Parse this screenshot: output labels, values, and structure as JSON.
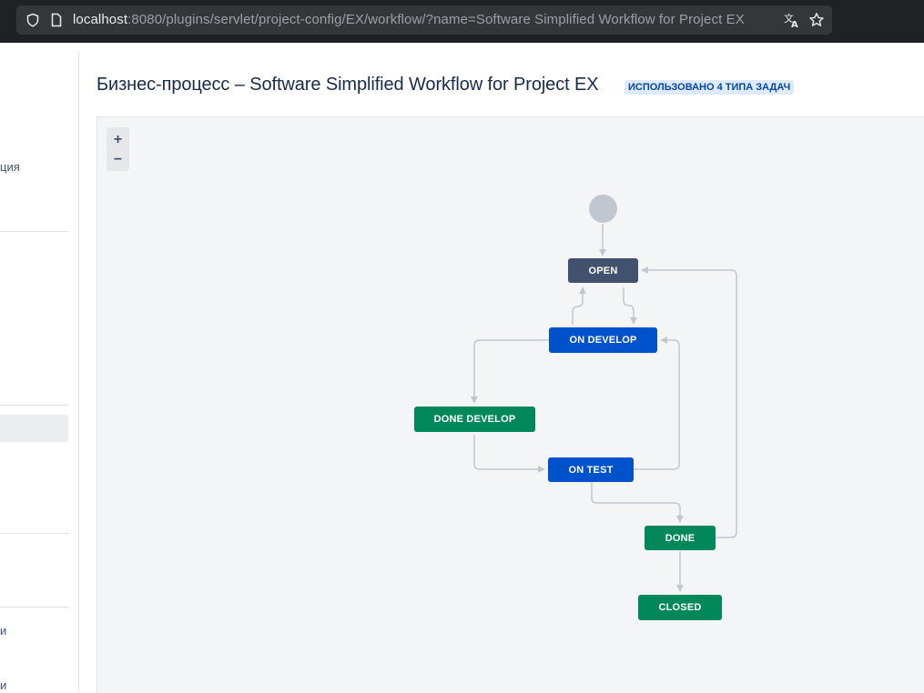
{
  "browser": {
    "url_host": "localhost",
    "url_rest": ":8080/plugins/servlet/project-config/EX/workflow/?name=Software Simplified Workflow for Project EX",
    "icons": [
      "shield-icon",
      "page-icon",
      "translate-icon",
      "bookmark-star-icon"
    ]
  },
  "sidebar": {
    "items": [
      {
        "label": "ция"
      },
      {
        "label": "и"
      },
      {
        "label": "и"
      }
    ]
  },
  "header": {
    "title": "Бизнес-процесс – Software Simplified Workflow for Project EX",
    "badge": "ИСПОЛЬЗОВАНО 4 ТИПА ЗАДАЧ"
  },
  "diagram": {
    "zoom_in": "+",
    "zoom_out": "−",
    "statuses": {
      "open": "OPEN",
      "on_develop": "ON DEVELOP",
      "done_develop": "DONE DEVELOP",
      "on_test": "ON TEST",
      "done": "DONE",
      "closed": "CLOSED"
    },
    "colors": {
      "todo": "#42526e",
      "in_progress": "#0052cc",
      "done": "#00875a",
      "connector": "#c1c7d0"
    }
  }
}
